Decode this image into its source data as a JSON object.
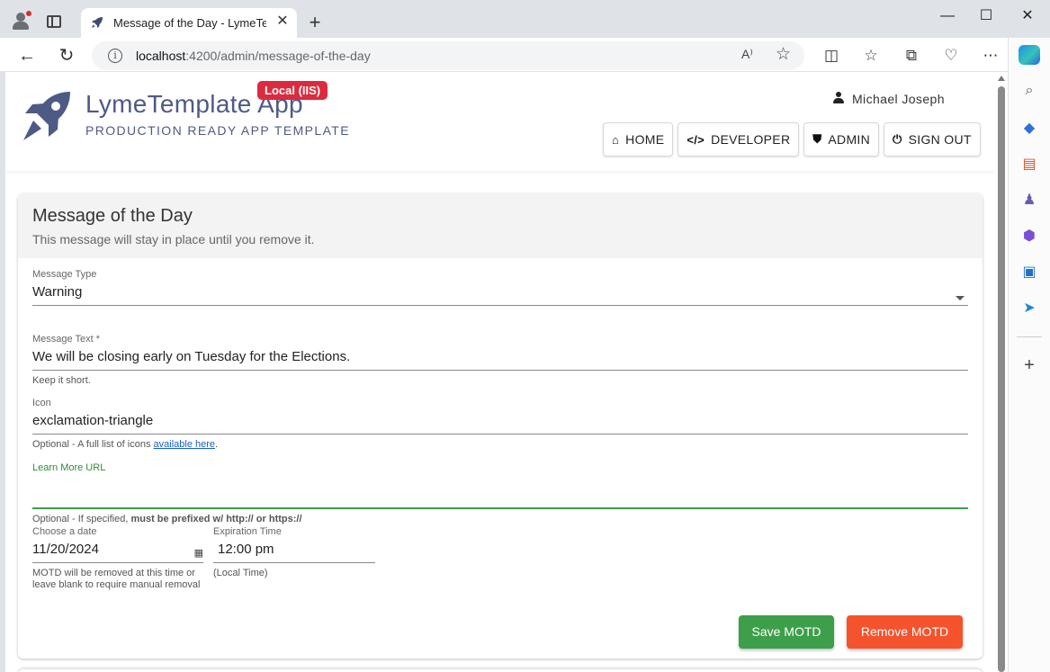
{
  "browser": {
    "tab_title": "Message of the Day - LymeTemplate App",
    "url_host": "localhost",
    "url_path": ":4200/admin/message-of-the-day",
    "read_aloud_label": "A⁾",
    "new_tab_symbol": "+",
    "tab_close_symbol": "✕",
    "window_controls": {
      "minimize": "—",
      "maximize": "☐",
      "close": "✕"
    }
  },
  "app": {
    "title": "LymeTemplate App",
    "subtitle": "PRODUCTION READY APP TEMPLATE",
    "env_badge": "Local (IIS)",
    "user_name": "Michael Joseph",
    "nav": [
      {
        "label": "HOME",
        "icon": "home-icon",
        "glyph": "⌂"
      },
      {
        "label": "DEVELOPER",
        "icon": "code-icon",
        "glyph": "</>"
      },
      {
        "label": "ADMIN",
        "icon": "shield-icon",
        "glyph": "⛊"
      },
      {
        "label": "SIGN OUT",
        "icon": "power-icon",
        "glyph": "⏻"
      }
    ],
    "colors": {
      "brand": "#4e5a86",
      "badge": "#dc2b3f",
      "save": "#3e9f4b",
      "remove": "#f4532d"
    }
  },
  "card": {
    "title": "Message of the Day",
    "subtitle": "This message will stay in place until you remove it."
  },
  "form": {
    "message_type": {
      "label": "Message Type",
      "value": "Warning"
    },
    "message_text": {
      "label": "Message Text *",
      "value": "We will be closing early on Tuesday for the Elections.",
      "hint": "Keep it short."
    },
    "icon": {
      "label": "Icon",
      "value": "exclamation-triangle",
      "hint_prefix": "Optional - A full list of icons ",
      "hint_link": "available here",
      "hint_suffix": "."
    },
    "learn_more": {
      "label": "Learn More URL",
      "value": "",
      "hint_prefix": "Optional - If specified, ",
      "hint_bold": "must be prefixed w/ http:// or https://"
    },
    "date": {
      "label": "Choose a date",
      "value": "11/20/2024",
      "hint": "MOTD will be removed at this time or leave blank to require manual removal"
    },
    "time": {
      "label": "Expiration Time",
      "value": "12:00 pm",
      "hint": "(Local Time)"
    }
  },
  "actions": {
    "save": "Save MOTD",
    "remove": "Remove MOTD"
  }
}
